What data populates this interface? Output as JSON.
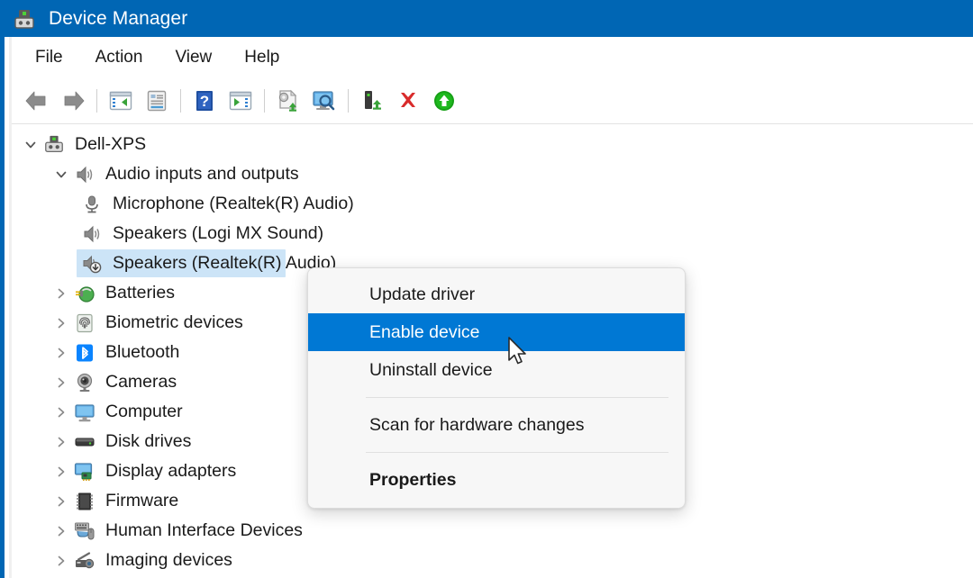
{
  "window": {
    "title": "Device Manager",
    "title_icon": "device-manager-icon",
    "accent_color": "#0066b4",
    "highlight_color": "#0078d4",
    "selection_color": "#cce4f7"
  },
  "menubar": {
    "items": [
      {
        "label": "File"
      },
      {
        "label": "Action"
      },
      {
        "label": "View"
      },
      {
        "label": "Help"
      }
    ]
  },
  "toolbar": {
    "buttons": [
      {
        "name": "back-arrow-icon",
        "tooltip": "Back"
      },
      {
        "name": "forward-arrow-icon",
        "tooltip": "Forward"
      },
      {
        "name": "show-hide-console-tree-icon",
        "tooltip": "Show/hide console tree"
      },
      {
        "name": "properties-icon",
        "tooltip": "Properties"
      },
      {
        "name": "help-icon",
        "tooltip": "Help"
      },
      {
        "name": "show-hide-action-pane-icon",
        "tooltip": "Show/hide action pane"
      },
      {
        "name": "update-driver-icon",
        "tooltip": "Update driver"
      },
      {
        "name": "scan-for-hardware-changes-icon",
        "tooltip": "Scan for hardware changes"
      },
      {
        "name": "enable-device-icon",
        "tooltip": "Enable device"
      },
      {
        "name": "uninstall-device-icon",
        "tooltip": "Uninstall device"
      },
      {
        "name": "disable-device-icon",
        "tooltip": "Disable device"
      }
    ]
  },
  "tree": {
    "nodes": [
      {
        "label": "Dell-XPS",
        "indent": 0,
        "chevron": "expanded",
        "icon": "computer-device-icon",
        "selected": false
      },
      {
        "label": "Audio inputs and outputs",
        "indent": 1,
        "chevron": "expanded",
        "icon": "speaker-icon",
        "selected": false
      },
      {
        "label": "Microphone (Realtek(R) Audio)",
        "indent": 2,
        "chevron": "none",
        "icon": "microphone-icon",
        "selected": false
      },
      {
        "label": "Speakers (Logi MX Sound)",
        "indent": 2,
        "chevron": "none",
        "icon": "speaker-icon",
        "selected": false
      },
      {
        "label": "Speakers (Realtek(R) Audio)",
        "indent": 2,
        "chevron": "none",
        "icon": "speaker-disabled-icon",
        "selected": true
      },
      {
        "label": "Batteries",
        "indent": 1,
        "chevron": "collapsed",
        "icon": "battery-icon",
        "selected": false
      },
      {
        "label": "Biometric devices",
        "indent": 1,
        "chevron": "collapsed",
        "icon": "fingerprint-icon",
        "selected": false
      },
      {
        "label": "Bluetooth",
        "indent": 1,
        "chevron": "collapsed",
        "icon": "bluetooth-icon",
        "selected": false
      },
      {
        "label": "Cameras",
        "indent": 1,
        "chevron": "collapsed",
        "icon": "camera-icon",
        "selected": false
      },
      {
        "label": "Computer",
        "indent": 1,
        "chevron": "collapsed",
        "icon": "monitor-icon",
        "selected": false
      },
      {
        "label": "Disk drives",
        "indent": 1,
        "chevron": "collapsed",
        "icon": "disk-drive-icon",
        "selected": false
      },
      {
        "label": "Display adapters",
        "indent": 1,
        "chevron": "collapsed",
        "icon": "display-adapter-icon",
        "selected": false
      },
      {
        "label": "Firmware",
        "indent": 1,
        "chevron": "collapsed",
        "icon": "firmware-chip-icon",
        "selected": false
      },
      {
        "label": "Human Interface Devices",
        "indent": 1,
        "chevron": "collapsed",
        "icon": "hid-icon",
        "selected": false
      },
      {
        "label": "Imaging devices",
        "indent": 1,
        "chevron": "collapsed",
        "icon": "imaging-device-icon",
        "selected": false
      }
    ]
  },
  "context_menu": {
    "items": [
      {
        "label": "Update driver",
        "highlighted": false,
        "bold": false
      },
      {
        "label": "Enable device",
        "highlighted": true,
        "bold": false
      },
      {
        "label": "Uninstall device",
        "highlighted": false,
        "bold": false
      },
      {
        "separator": true
      },
      {
        "label": "Scan for hardware changes",
        "highlighted": false,
        "bold": false
      },
      {
        "separator": true
      },
      {
        "label": "Properties",
        "highlighted": false,
        "bold": true
      }
    ]
  }
}
